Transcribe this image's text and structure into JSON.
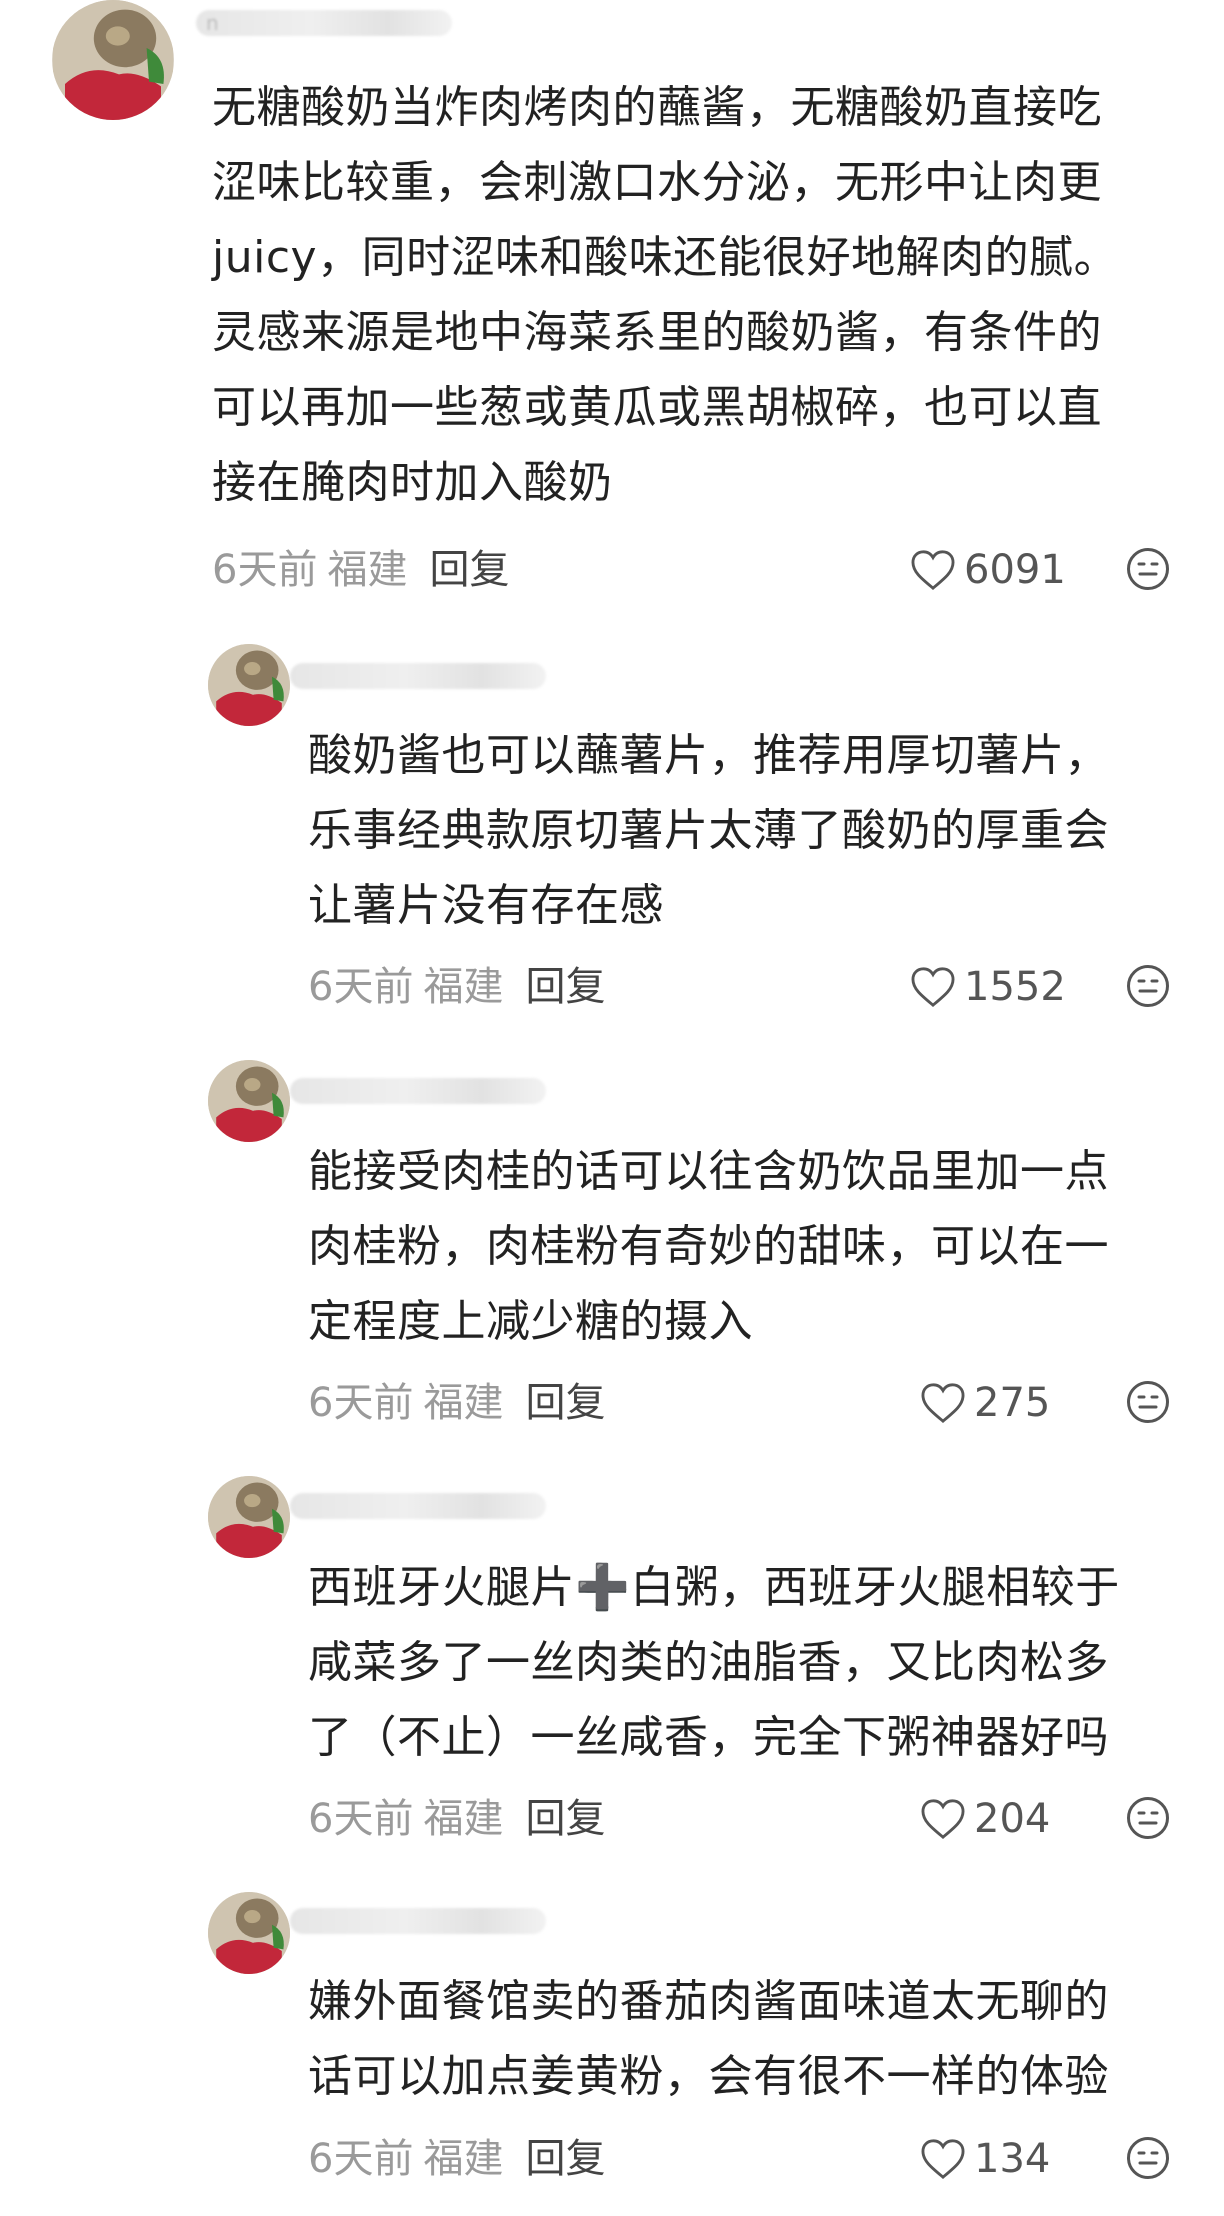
{
  "comments": [
    {
      "username": "n",
      "lines": [
        "无糖酸奶当炸肉烤肉的蘸酱，无糖酸奶直接吃",
        "涩味比较重，会刺激口水分泌，无形中让肉更",
        "juicy，同时涩味和酸味还能很好地解肉的腻。",
        "灵感来源是地中海菜系里的酸奶酱，有条件的",
        "可以再加一些葱或黄瓜或黑胡椒碎，也可以直",
        "接在腌肉时加入酸奶"
      ],
      "time": "6天前",
      "location": "福建",
      "reply_label": "回复",
      "likes": "6091"
    },
    {
      "username": "",
      "lines": [
        "酸奶酱也可以蘸薯片，推荐用厚切薯片，",
        "乐事经典款原切薯片太薄了酸奶的厚重会",
        "让薯片没有存在感"
      ],
      "time": "6天前",
      "location": "福建",
      "reply_label": "回复",
      "likes": "1552"
    },
    {
      "username": "",
      "lines": [
        "能接受肉桂的话可以往含奶饮品里加一点",
        "肉桂粉，肉桂粉有奇妙的甜味，可以在一",
        "定程度上减少糖的摄入"
      ],
      "time": "6天前",
      "location": "福建",
      "reply_label": "回复",
      "likes": "275"
    },
    {
      "username": "",
      "lines": [
        "西班牙火腿片➕白粥，西班牙火腿相较于",
        "咸菜多了一丝肉类的油脂香，又比肉松多",
        "了（不止）一丝咸香，完全下粥神器好吗"
      ],
      "time": "6天前",
      "location": "福建",
      "reply_label": "回复",
      "likes": "204"
    },
    {
      "username": "",
      "lines": [
        "嫌外面餐馆卖的番茄肉酱面味道太无聊的",
        "话可以加点姜黄粉，会有很不一样的体验"
      ],
      "time": "6天前",
      "location": "福建",
      "reply_label": "回复",
      "likes": "134"
    }
  ],
  "icons": {
    "like": "heart-outline-icon",
    "more": "face-emoji-icon"
  },
  "colors": {
    "text": "#222222",
    "meta": "#9a9a9a",
    "reply": "#444444"
  }
}
